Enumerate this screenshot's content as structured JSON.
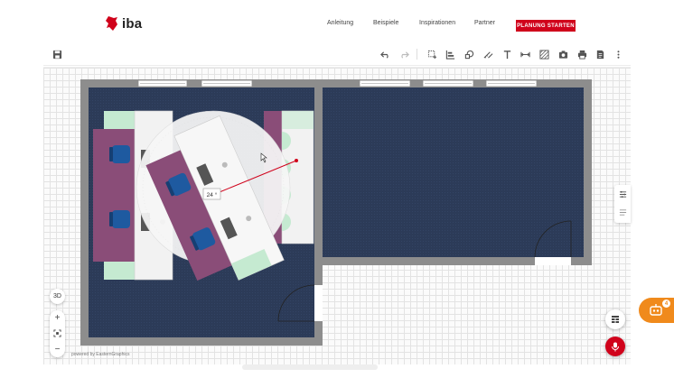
{
  "brand": {
    "name": "iba",
    "color": "#d0021b"
  },
  "nav": {
    "items": [
      {
        "label": "Anleitung"
      },
      {
        "label": "Beispiele"
      },
      {
        "label": "Inspirationen"
      },
      {
        "label": "Partner"
      }
    ],
    "cta_label": "PLANUNG STARTEN"
  },
  "toolbar": {
    "tools": [
      "save-icon",
      "undo-icon",
      "redo-icon",
      "select-area-icon",
      "align-icon",
      "shapes-icon",
      "measure-icon",
      "text-icon",
      "dimension-icon",
      "hatch-icon",
      "camera-icon",
      "print-icon",
      "document-icon",
      "more-icon"
    ]
  },
  "canvas": {
    "angle_label": "24 °",
    "view_toggle_label": "3D",
    "powered_by": "powered by EasternGraphics",
    "floor_color": "#2b3a55",
    "wall_color": "#8a8a8a"
  },
  "chat": {
    "badge": "4"
  }
}
